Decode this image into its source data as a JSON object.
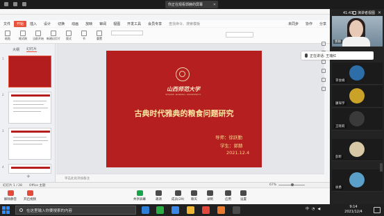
{
  "top_banner": {
    "sharing_status": "你正在观看郭赫的屏幕",
    "close_icon": "close-icon"
  },
  "ppt": {
    "menu": [
      "文件",
      "开始",
      "插入",
      "设计",
      "切换",
      "动画",
      "放映",
      "审阅",
      "视图",
      "开发工具",
      "会员专享",
      "查找命令、搜索模板"
    ],
    "active_menu": "开始",
    "right_actions": [
      "未同步",
      "协作",
      "分享"
    ],
    "ribbon_buttons": [
      "粘贴",
      "格式刷",
      "当前开始",
      "新建幻灯片",
      "版式",
      "节",
      "重置"
    ],
    "panel_tabs": [
      "大纲",
      "幻灯片"
    ],
    "active_panel_tab": "幻灯片",
    "slide_numbers": [
      "1",
      "2",
      "3",
      "4",
      "5"
    ],
    "slide": {
      "university_cn": "山西师范大学",
      "university_en": "SHANXI NORMAL UNIVERSITY",
      "title": "古典时代雅典的粮食问题研究",
      "advisor": "导师：",
      "advisor_name": "徐跃勤",
      "student": "学生：",
      "student_name": "郭赫",
      "date": "2021.12.4"
    },
    "notes_placeholder": "单击此处添加备注",
    "status_left": "幻灯片 1 / 28",
    "theme": "Office 主题",
    "zoom_level": "67%",
    "colors": {
      "accent": "#e8533b",
      "slide_bg": "#b51f1f",
      "title": "#fbe7a1"
    }
  },
  "meeting": {
    "controls": [
      "解除静音",
      "开启视频",
      "共享屏幕",
      "邀请",
      "成员(29)",
      "聊天",
      "录制",
      "应用",
      "设置"
    ],
    "time": "41:43",
    "view_label": "演讲者视图",
    "speaker_name": "郭赫",
    "speaking_tip": "正在讲话: 王瑞红",
    "participants": [
      {
        "name": "李会娟",
        "avatar_color": "#2d6ea8"
      },
      {
        "name": "康琛宇",
        "avatar_color": "#c9a227"
      },
      {
        "name": "王晓莉",
        "avatar_color": "#3a3a3a"
      },
      {
        "name": "彭昕",
        "avatar_color": "#d7c9a6"
      },
      {
        "name": "徐勇",
        "avatar_color": "#5aa0c8"
      }
    ]
  },
  "taskbar": {
    "search_placeholder": "在这里输入你要搜索的内容",
    "clock_time": "9:14",
    "clock_date": "2021/12/4",
    "tray_lang": "中"
  }
}
